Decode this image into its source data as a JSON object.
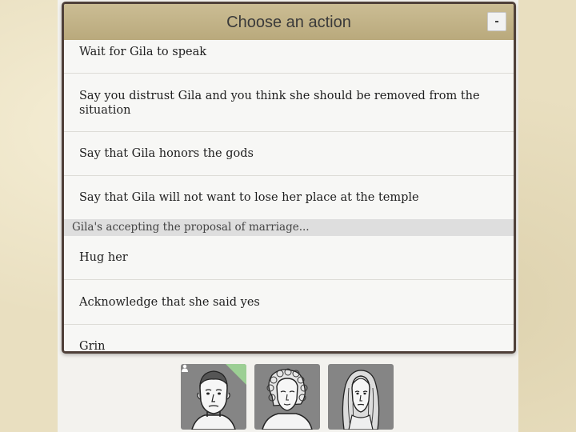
{
  "dialog": {
    "title": "Choose an action",
    "minimize_label": "-"
  },
  "options_group_1": [
    {
      "label": "Wait for Gila to speak"
    },
    {
      "label": "Say you distrust Gila and you think she should be removed from the situation"
    },
    {
      "label": "Say that Gila honors the gods"
    },
    {
      "label": "Say that Gila will not want to lose her place at the temple"
    }
  ],
  "section": {
    "label": "Gila's accepting the proposal of marriage..."
  },
  "options_group_2": [
    {
      "label": "Hug her"
    },
    {
      "label": "Acknowledge that she said yes"
    },
    {
      "label": "Grin"
    }
  ],
  "portraits": [
    {
      "name": "player-portrait",
      "active": true,
      "icon": "person-icon"
    },
    {
      "name": "curly-hair-woman-portrait",
      "active": false
    },
    {
      "name": "long-hair-woman-portrait",
      "active": false
    }
  ]
}
